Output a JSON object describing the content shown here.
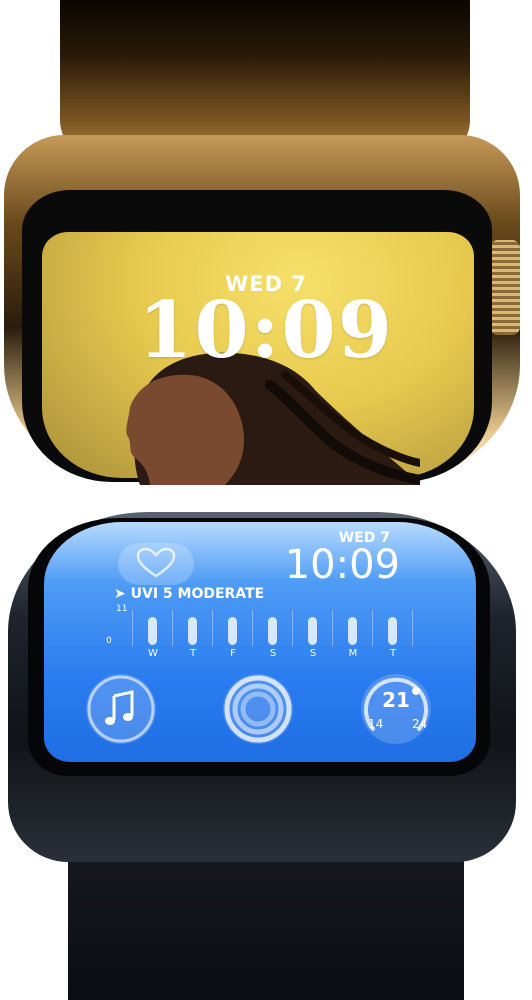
{
  "gold_watch": {
    "date": "WED 7",
    "time": "10:09"
  },
  "midnight_watch": {
    "date": "WED 7",
    "time": "10:09",
    "uv": {
      "label": "UVI 5 MODERATE",
      "scale_max": "11",
      "scale_min": "0",
      "days": [
        "W",
        "T",
        "F",
        "S",
        "S",
        "M",
        "T"
      ]
    },
    "temperature": {
      "current": "21",
      "low": "14",
      "high": "24"
    }
  },
  "colors": {
    "gold_screen": "#e7c94e",
    "midnight_screen": "#2b7cf0"
  },
  "icons": {
    "heart": "heart-icon",
    "music": "music-note-icon",
    "activity": "activity-rings-icon",
    "location": "location-arrow-icon"
  }
}
